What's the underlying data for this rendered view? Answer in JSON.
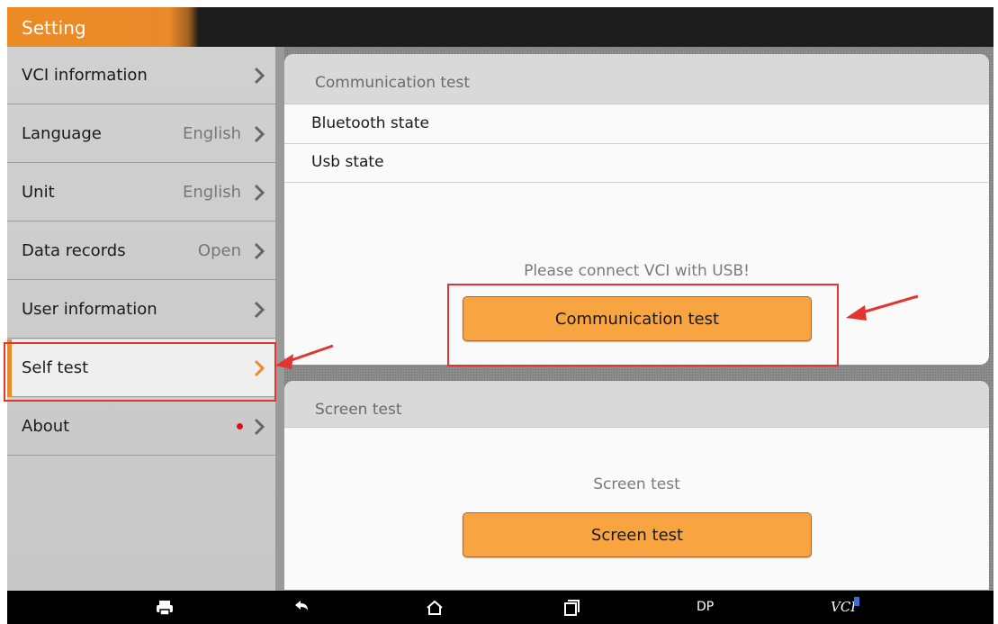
{
  "app": {
    "title": "Setting"
  },
  "sidebar": {
    "items": [
      {
        "label": "VCI information",
        "value": ""
      },
      {
        "label": "Language",
        "value": "English"
      },
      {
        "label": "Unit",
        "value": "English"
      },
      {
        "label": "Data records",
        "value": "Open"
      },
      {
        "label": "User information",
        "value": ""
      },
      {
        "label": "Self test",
        "value": "",
        "active": true
      },
      {
        "label": "About",
        "value": "",
        "badge": "red-dot"
      }
    ]
  },
  "comm_card": {
    "header": "Communication test",
    "rows": [
      "Bluetooth state",
      "Usb state"
    ],
    "hint": "Please connect VCI with USB!",
    "button": "Communication test"
  },
  "screen_card": {
    "header": "Screen test",
    "hint": "Screen test",
    "button": "Screen test"
  },
  "navbar": {
    "dp_label": "DP",
    "vci_label": "VCI",
    "icons": [
      "printer-icon",
      "back-icon",
      "home-icon",
      "recents-icon"
    ]
  },
  "colors": {
    "accent": "#e98a2b",
    "button": "#f7a441",
    "annotation": "#e2352f",
    "badge": "#e0101a"
  }
}
